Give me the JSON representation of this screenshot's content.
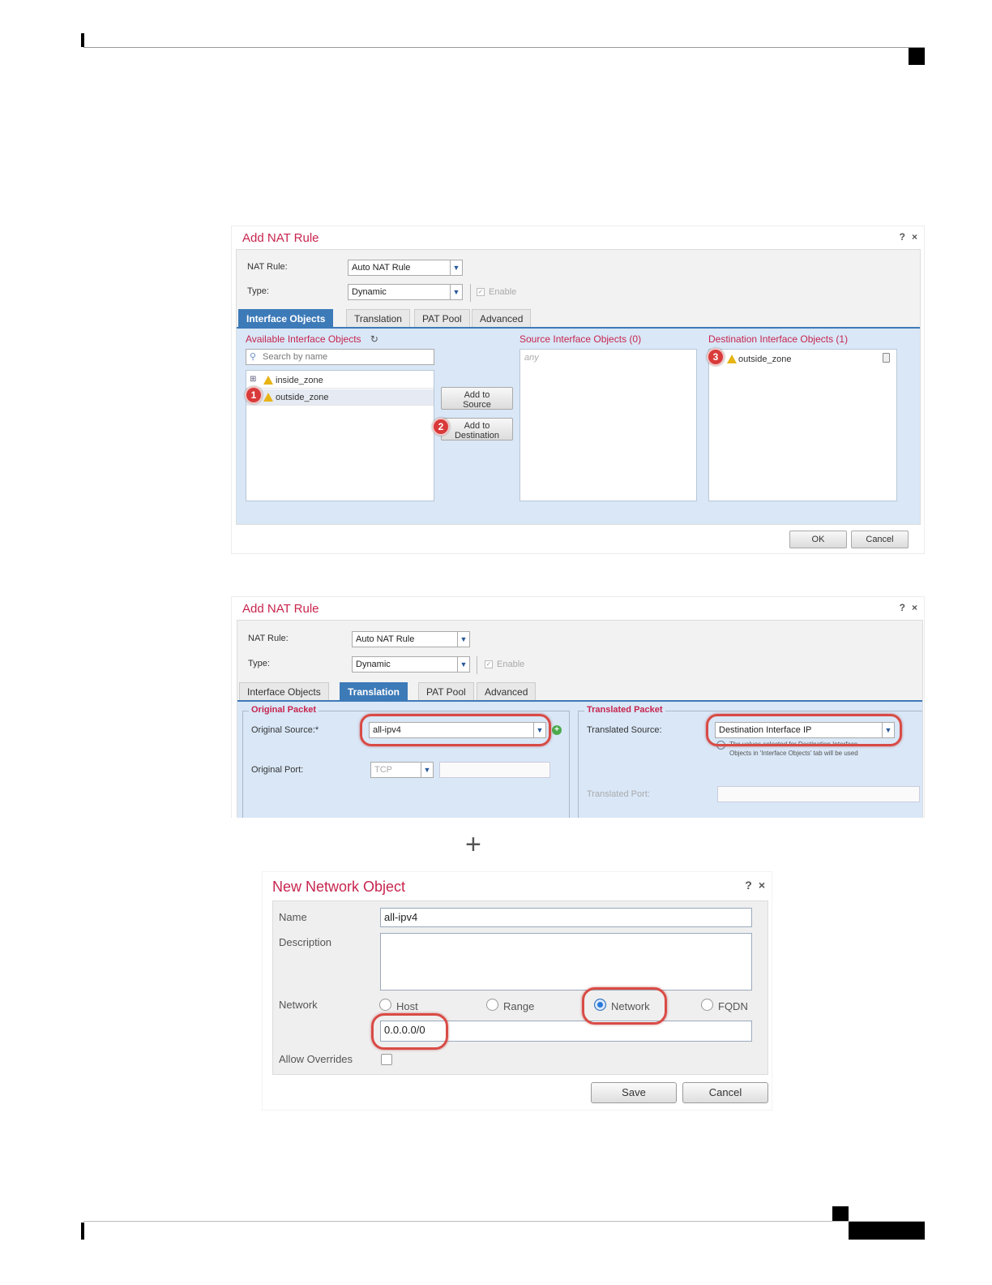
{
  "dialog1": {
    "title": "Add NAT Rule",
    "help": "?",
    "close": "×",
    "nat_rule_label": "NAT Rule:",
    "nat_rule_value": "Auto NAT Rule",
    "type_label": "Type:",
    "type_value": "Dynamic",
    "enable_label": "Enable",
    "tabs": [
      "Interface Objects",
      "Translation",
      "PAT Pool",
      "Advanced"
    ],
    "available_title": "Available Interface Objects",
    "search_placeholder": "Search by name",
    "available_items": [
      "inside_zone",
      "outside_zone"
    ],
    "add_source": [
      "Add to",
      "Source"
    ],
    "add_destination": [
      "Add to",
      "Destination"
    ],
    "source_title": "Source Interface Objects (0)",
    "source_placeholder": "any",
    "destination_title": "Destination Interface Objects (1)",
    "destination_items": [
      "outside_zone"
    ],
    "ok": "OK",
    "cancel": "Cancel",
    "badges": [
      "1",
      "2",
      "3"
    ]
  },
  "dialog2": {
    "title": "Add NAT Rule",
    "help": "?",
    "close": "×",
    "nat_rule_label": "NAT Rule:",
    "nat_rule_value": "Auto NAT Rule",
    "type_label": "Type:",
    "type_value": "Dynamic",
    "enable_label": "Enable",
    "tabs": [
      "Interface Objects",
      "Translation",
      "PAT Pool",
      "Advanced"
    ],
    "original_packet": "Original Packet",
    "original_source_label": "Original Source:*",
    "original_source_value": "all-ipv4",
    "original_port_label": "Original Port:",
    "original_port_value": "TCP",
    "translated_packet": "Translated Packet",
    "translated_source_label": "Translated Source:",
    "translated_source_value": "Destination Interface IP",
    "note_line1": "The values selected for Destination Interface",
    "note_line2": "Objects in 'Interface Objects' tab will be used",
    "translated_port_label": "Translated Port:"
  },
  "plus": "+",
  "dialog3": {
    "title": "New Network Object",
    "help": "?",
    "close": "×",
    "name_label": "Name",
    "name_value": "all-ipv4",
    "description_label": "Description",
    "network_label": "Network",
    "radio_options": [
      "Host",
      "Range",
      "Network",
      "FQDN"
    ],
    "selected_option": "Network",
    "network_value": "0.0.0.0/0",
    "allow_overrides_label": "Allow Overrides",
    "save": "Save",
    "cancel": "Cancel"
  },
  "colors": {
    "title_red": "#c7254e",
    "tab_blue": "#3d7ab8",
    "panel_blue": "#d9e7f7",
    "highlight_red": "#d94b45"
  }
}
